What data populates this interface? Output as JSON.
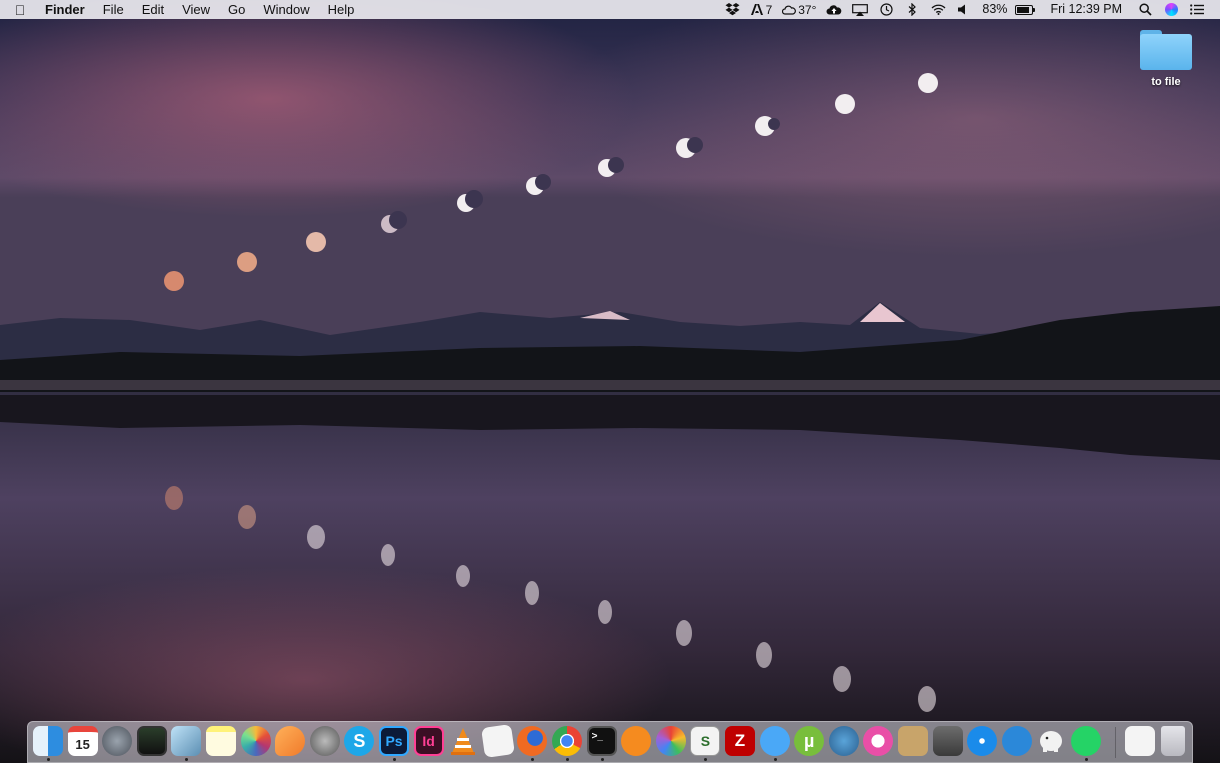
{
  "menubar": {
    "app_name": "Finder",
    "menus": [
      "File",
      "Edit",
      "View",
      "Go",
      "Window",
      "Help"
    ],
    "status": {
      "adobe_count": "7",
      "weather": "37°",
      "battery": "83%",
      "battery_level": 0.83,
      "clock": "Fri 12:39 PM"
    },
    "icons": [
      "dropbox-icon",
      "adobe-icon",
      "weather-icon",
      "cloud-upload-icon",
      "airplay-icon",
      "time-machine-icon",
      "bluetooth-icon",
      "wifi-icon",
      "volume-icon",
      "battery-icon",
      "spotlight-icon",
      "siri-icon",
      "notification-center-icon"
    ]
  },
  "desktop": {
    "items": [
      {
        "label": "to file",
        "icon": "folder-icon"
      }
    ]
  },
  "dock": {
    "apps": [
      {
        "name": "finder-icon",
        "running": true
      },
      {
        "name": "calendar-icon",
        "text": "15",
        "running": false
      },
      {
        "name": "launchpad-icon",
        "running": false
      },
      {
        "name": "mission-control-icon",
        "running": false
      },
      {
        "name": "preview-icon",
        "running": true
      },
      {
        "name": "notes-icon",
        "running": false
      },
      {
        "name": "photos-icon",
        "running": false
      },
      {
        "name": "slides-app-icon",
        "running": false
      },
      {
        "name": "system-preferences-icon",
        "running": false
      },
      {
        "name": "skype-icon",
        "text": "S",
        "running": false
      },
      {
        "name": "photoshop-icon",
        "text": "Ps",
        "running": true
      },
      {
        "name": "indesign-icon",
        "text": "Id",
        "running": false
      },
      {
        "name": "vlc-icon",
        "running": false
      },
      {
        "name": "textedit-icon",
        "running": false
      },
      {
        "name": "firefox-icon",
        "running": true
      },
      {
        "name": "chrome-icon",
        "running": true
      },
      {
        "name": "terminal-icon",
        "text": ">_",
        "running": true
      },
      {
        "name": "ibooks-icon",
        "running": false
      },
      {
        "name": "picasa-icon",
        "running": false
      },
      {
        "name": "scrivener-icon",
        "text": "S",
        "running": true
      },
      {
        "name": "filezilla-icon",
        "text": "Z",
        "running": false
      },
      {
        "name": "messages-icon",
        "running": true
      },
      {
        "name": "utorrent-icon",
        "text": "µ",
        "running": false
      },
      {
        "name": "itunes-icon",
        "running": false
      },
      {
        "name": "music-icon",
        "running": false
      },
      {
        "name": "contacts-icon",
        "running": false
      },
      {
        "name": "calculator-icon",
        "running": false
      },
      {
        "name": "safari-icon",
        "running": false
      },
      {
        "name": "wunderlist-icon",
        "running": false
      },
      {
        "name": "evernote-icon",
        "running": false
      },
      {
        "name": "whatsapp-icon",
        "running": true
      },
      {
        "name": "archive-icon",
        "running": false
      },
      {
        "name": "trash-icon",
        "running": false
      }
    ]
  }
}
